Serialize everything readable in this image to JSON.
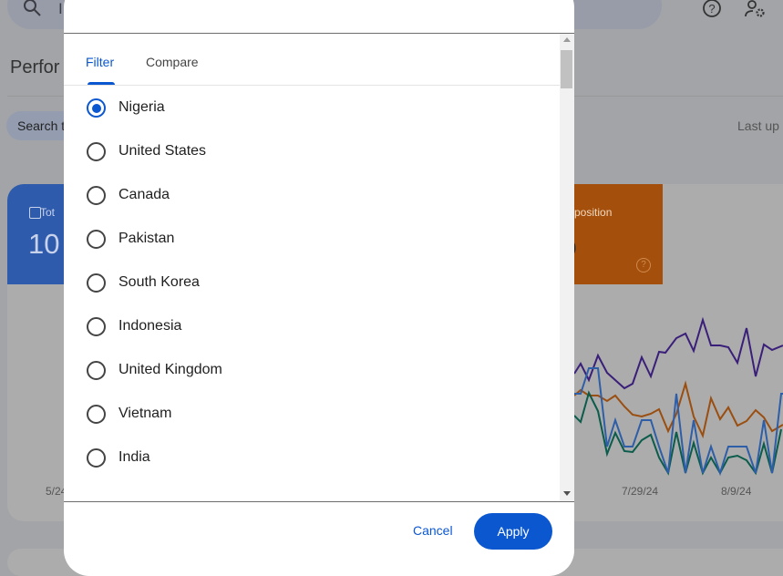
{
  "header": {
    "search_partial": "I",
    "help_icon": "help-circle-icon",
    "admin_icon": "manage-accounts-icon"
  },
  "page": {
    "title_partial": "Perfor",
    "search_type_partial": "Search t",
    "last_updated_partial": "Last up"
  },
  "metrics": {
    "clicks_label_partial": "Tot",
    "clicks_value_partial": "10",
    "position_label_partial": "e position",
    "position_value_partial": "0"
  },
  "chart": {
    "x_ticks": [
      "5/24",
      "7/29/24",
      "8/9/24"
    ],
    "colors": {
      "clicks": "#2e5ea8",
      "impressions": "#3a1f7a",
      "ctr": "#0b5c4a",
      "position": "#9a4e10"
    }
  },
  "dialog": {
    "tabs": [
      {
        "label": "Filter",
        "active": true
      },
      {
        "label": "Compare",
        "active": false
      }
    ],
    "options": [
      {
        "label": "Nigeria",
        "selected": true
      },
      {
        "label": "United States",
        "selected": false
      },
      {
        "label": "Canada",
        "selected": false
      },
      {
        "label": "Pakistan",
        "selected": false
      },
      {
        "label": "South Korea",
        "selected": false
      },
      {
        "label": "Indonesia",
        "selected": false
      },
      {
        "label": "United Kingdom",
        "selected": false
      },
      {
        "label": "Vietnam",
        "selected": false
      },
      {
        "label": "India",
        "selected": false
      }
    ],
    "cancel_label": "Cancel",
    "apply_label": "Apply",
    "accent": "#0b57d0"
  }
}
